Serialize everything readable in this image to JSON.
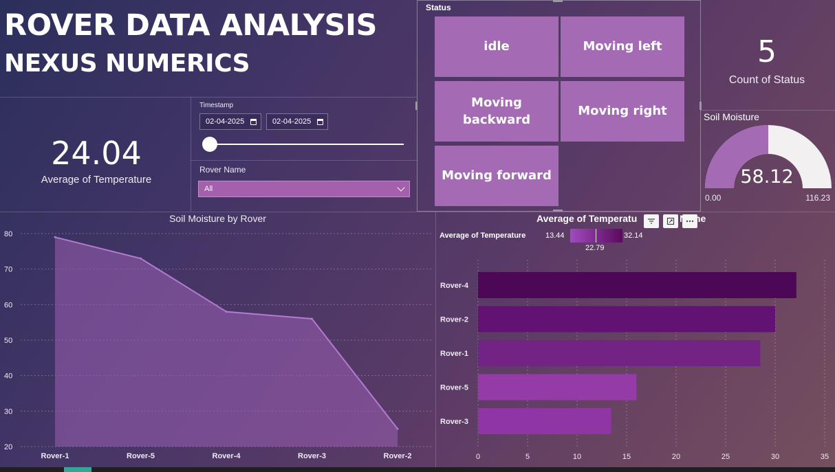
{
  "header": {
    "title_line1": "ROVER DATA ANALYSIS",
    "title_line2": "NEXUS NUMERICS"
  },
  "kpi_temperature": {
    "value": "24.04",
    "label": "Average of  Temperature"
  },
  "slicers": {
    "timestamp_label": "Timestamp",
    "date_start": "02-04-2025",
    "date_end": "02-04-2025",
    "rover_label": "Rover Name",
    "rover_selected": "All"
  },
  "status": {
    "title": "Status",
    "tiles": [
      {
        "label": "idle"
      },
      {
        "label": "Moving left"
      },
      {
        "label": "Moving backward"
      },
      {
        "label": "Moving right"
      },
      {
        "label": "Moving forward"
      }
    ]
  },
  "kpi_count": {
    "value": "5",
    "label": "Count of  Status"
  },
  "gauge": {
    "title": "Soil Moisture",
    "value": 58.12,
    "value_text": "58.12",
    "min": 0,
    "max": 116.23,
    "min_text": "0.00",
    "max_text": "116.23",
    "fill_color": "#a46ab3",
    "track_color": "#f2f0f0"
  },
  "chart_data": [
    {
      "type": "area",
      "title": "Soil Moisture by Rover",
      "categories": [
        "Rover-1",
        "Rover-5",
        "Rover-4",
        "Rover-3",
        "Rover-2"
      ],
      "values": [
        79,
        73,
        58,
        56,
        25
      ],
      "ylim": [
        20,
        80
      ],
      "yticks": [
        "20",
        "30",
        "40",
        "50",
        "60",
        "70",
        "80"
      ],
      "grid": true,
      "color": "#9a5fb3"
    },
    {
      "type": "bar",
      "orientation": "horizontal",
      "title_visible": "Average of Temperatu",
      "title_tail": "Name",
      "categories": [
        "Rover-4",
        "Rover-2",
        "Rover-1",
        "Rover-5",
        "Rover-3"
      ],
      "values": [
        32.14,
        30.0,
        28.5,
        16.0,
        13.44
      ],
      "xlim": [
        0,
        35
      ],
      "xticks": [
        "0",
        "5",
        "10",
        "15",
        "20",
        "25",
        "30",
        "35"
      ],
      "colors": [
        "#4c0757",
        "#621272",
        "#712483",
        "#943ba8",
        "#8f35a4"
      ],
      "legend": {
        "label": "Average of  Temperature",
        "min": "13.44",
        "max": "32.14",
        "mid": "22.79"
      }
    }
  ]
}
